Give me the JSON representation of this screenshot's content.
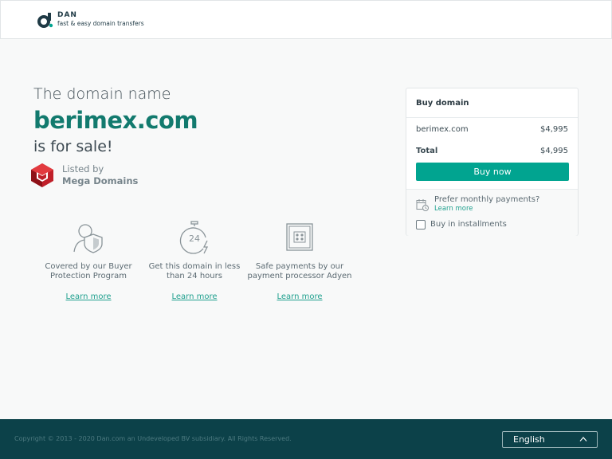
{
  "header": {
    "brand_name": "DAN",
    "brand_tagline": "fast & easy domain transfers"
  },
  "hero": {
    "pre": "The domain name",
    "domain": "berimex.com",
    "post": "is for sale!"
  },
  "listed": {
    "label": "Listed by",
    "seller": "Mega Domains"
  },
  "features": [
    {
      "icon": "shield-person-icon",
      "text": "Covered by our Buyer Protection Program",
      "link": "Learn more"
    },
    {
      "icon": "stopwatch-24-icon",
      "text": "Get this domain in less than 24 hours",
      "link": "Learn more"
    },
    {
      "icon": "safe-icon",
      "text": "Safe payments by our payment processor Adyen",
      "link": "Learn more"
    }
  ],
  "card": {
    "title": "Buy domain",
    "item_name": "berimex.com",
    "item_price": "$4,995",
    "total_label": "Total",
    "total_price": "$4,995",
    "buy_label": "Buy now",
    "monthly_question": "Prefer monthly payments?",
    "monthly_link": "Learn more",
    "installments_label": "Buy in installments",
    "installments_checked": false
  },
  "footer": {
    "copyright": "Copyright © 2013 - 2020 Dan.com an Undeveloped BV subsidiary. All Rights Reserved.",
    "language": "English"
  },
  "colors": {
    "accent": "#01a490",
    "domain_text": "#127a6e",
    "footer_bg": "#0c4149",
    "link": "#1fa08e"
  }
}
